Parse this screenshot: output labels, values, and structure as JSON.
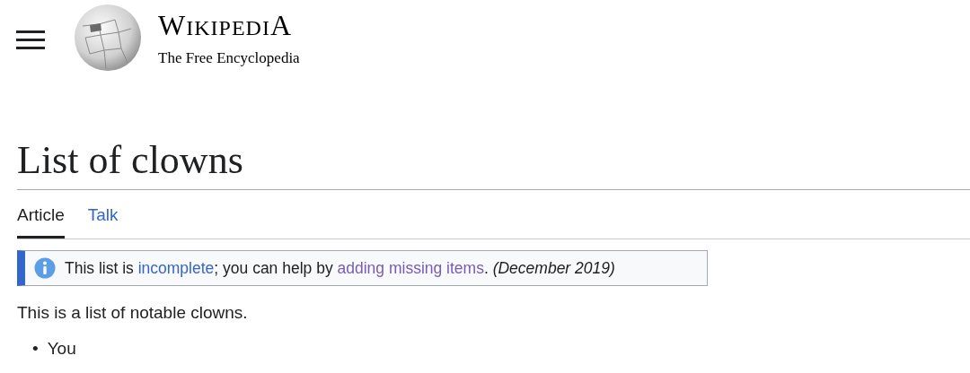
{
  "header": {
    "wordmark": "WIKIPEDIA",
    "tagline": "The Free Encyclopedia"
  },
  "page_title": "List of clowns",
  "tabs": [
    {
      "label": "Article",
      "selected": true
    },
    {
      "label": "Talk",
      "selected": false
    }
  ],
  "notice": {
    "parts": [
      {
        "kind": "text",
        "text": "This list is "
      },
      {
        "kind": "link",
        "text": "incomplete",
        "visited": false
      },
      {
        "kind": "text",
        "text": "; you can help by "
      },
      {
        "kind": "link",
        "text": "adding missing items",
        "visited": true
      },
      {
        "kind": "text",
        "text": ". *(December 2019)*"
      }
    ]
  },
  "intro": "This is a list of notable clowns.",
  "items": [
    {
      "marker": "•",
      "text": "You"
    }
  ]
}
